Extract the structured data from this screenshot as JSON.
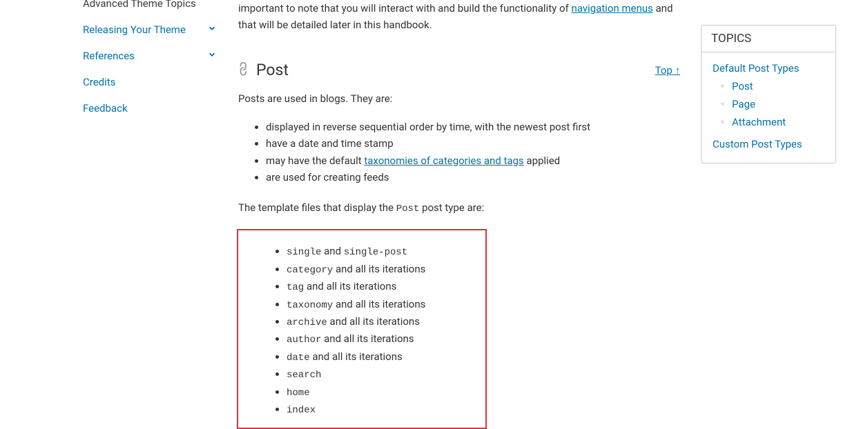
{
  "sidebar": {
    "items": [
      {
        "label": "Advanced Theme Topics",
        "expandable": false
      },
      {
        "label": "Releasing Your Theme",
        "expandable": true
      },
      {
        "label": "References",
        "expandable": true
      },
      {
        "label": "Credits",
        "expandable": false
      },
      {
        "label": "Feedback",
        "expandable": false
      }
    ]
  },
  "intro": {
    "prefix": "important to note that you will interact with and build the functionality of ",
    "link": "navigation menus",
    "suffix": " and that will be detailed later in this handbook."
  },
  "section": {
    "title": "Post",
    "top_link": "Top ↑"
  },
  "posts_intro": "Posts are used in blogs. They are:",
  "post_bullets": {
    "b0": "displayed in reverse sequential order by time, with the newest post first",
    "b1": "have a date and time stamp",
    "b2_prefix": "may have the default ",
    "b2_link": "taxonomies of categories and tags",
    "b2_suffix": " applied",
    "b3": "are used for creating feeds"
  },
  "templates_intro": {
    "prefix": "The template files that display the ",
    "code": "Post",
    "suffix": " post type are:"
  },
  "template_list": {
    "t0_c1": "single",
    "t0_mid": " and ",
    "t0_c2": "single-post",
    "t1_c": "category",
    "t1_tail": " and all its iterations",
    "t2_c": "tag",
    "t2_tail": " and all its iterations",
    "t3_c": "taxonomy",
    "t3_tail": " and all its iterations",
    "t4_c": "archive",
    "t4_tail": " and all its iterations",
    "t5_c": "author",
    "t5_tail": " and all its iterations",
    "t6_c": "date",
    "t6_tail": " and all its iterations",
    "t7_c": "search",
    "t8_c": "home",
    "t9_c": "index"
  },
  "topics": {
    "header": "TOPICS",
    "items": {
      "i0": "Default Post Types",
      "sub": {
        "s0": "Post",
        "s1": "Page",
        "s2": "Attachment"
      },
      "i1": "Custom Post Types"
    }
  }
}
